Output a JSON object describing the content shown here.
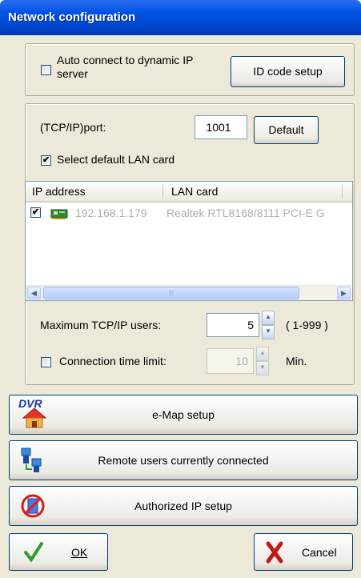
{
  "window": {
    "title": "Network configuration"
  },
  "top_group": {
    "auto_connect_label": "Auto connect to dynamic IP server",
    "auto_connect_line1": "Auto connect to dynamic IP",
    "auto_connect_line2": "server",
    "auto_connect_checked": false,
    "id_code_button": "ID code setup"
  },
  "tcp": {
    "port_label": "(TCP/IP)port:",
    "port_value": "1001",
    "default_button": "Default",
    "select_lan_label": "Select default LAN card",
    "select_lan_checked": true
  },
  "list": {
    "columns": [
      "IP address",
      "LAN card"
    ],
    "rows": [
      {
        "checked": true,
        "ip": "192.168.1.179",
        "card": "Realtek RTL8168/8111 PCI-E G"
      }
    ]
  },
  "users": {
    "max_label": "Maximum TCP/IP users:",
    "max_value": "5",
    "range": "( 1-999 )",
    "time_limit_label": "Connection time limit:",
    "time_limit_checked": false,
    "time_value": "10",
    "time_unit": "Min."
  },
  "buttons": {
    "emap": "e-Map setup",
    "emap_icon_text": "DVR",
    "remote": "Remote users currently connected",
    "authorized": "Authorized IP setup",
    "ok": "OK",
    "cancel": "Cancel"
  }
}
